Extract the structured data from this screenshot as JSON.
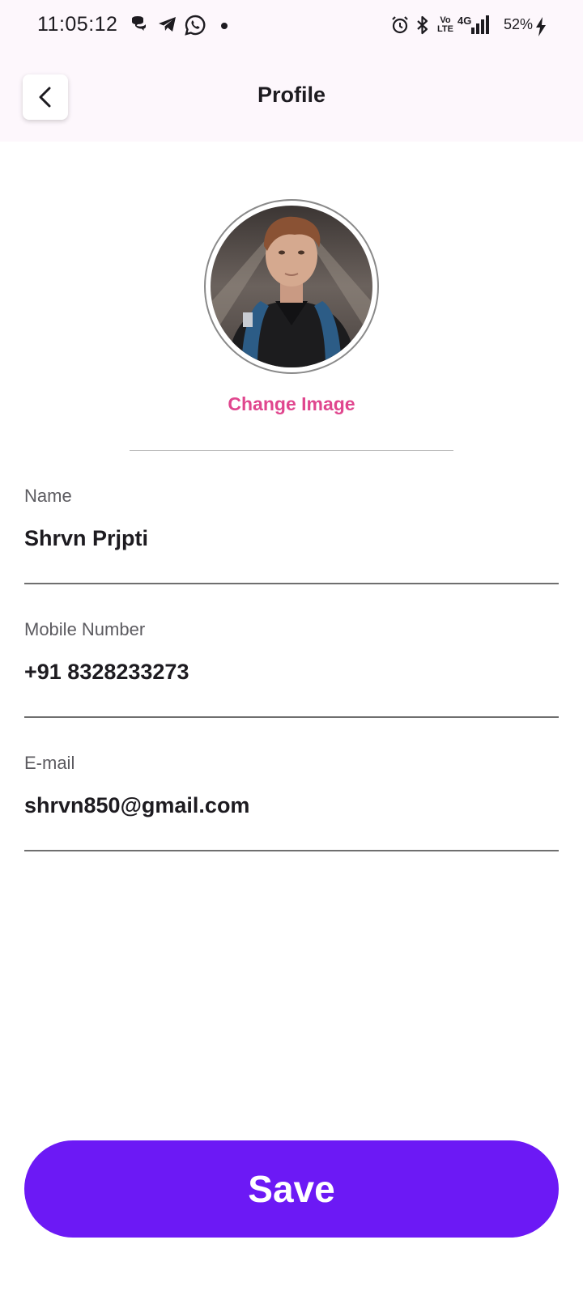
{
  "status_bar": {
    "time": "11:05:12",
    "left_icons": [
      "chat-bubbles-icon",
      "telegram-icon",
      "whatsapp-icon",
      "dot-icon"
    ],
    "right_icons": [
      "alarm-icon",
      "bluetooth-icon",
      "volte-icon",
      "signal-4g-icon",
      "charging-icon"
    ],
    "battery": "52%",
    "volte_label": "Vo LTE",
    "network_label": "4G"
  },
  "app_bar": {
    "title": "Profile",
    "back_icon": "chevron-left-icon"
  },
  "profile": {
    "change_image_label": "Change Image",
    "accent_color": "#e0468e"
  },
  "fields": {
    "name": {
      "label": "Name",
      "value": "Shrvn Prjpti"
    },
    "mobile": {
      "label": "Mobile Number",
      "value": "+91 8328233273"
    },
    "email": {
      "label": "E-mail",
      "value": "shrvn850@gmail.com"
    }
  },
  "actions": {
    "save_label": "Save",
    "save_color": "#6c19f5"
  }
}
